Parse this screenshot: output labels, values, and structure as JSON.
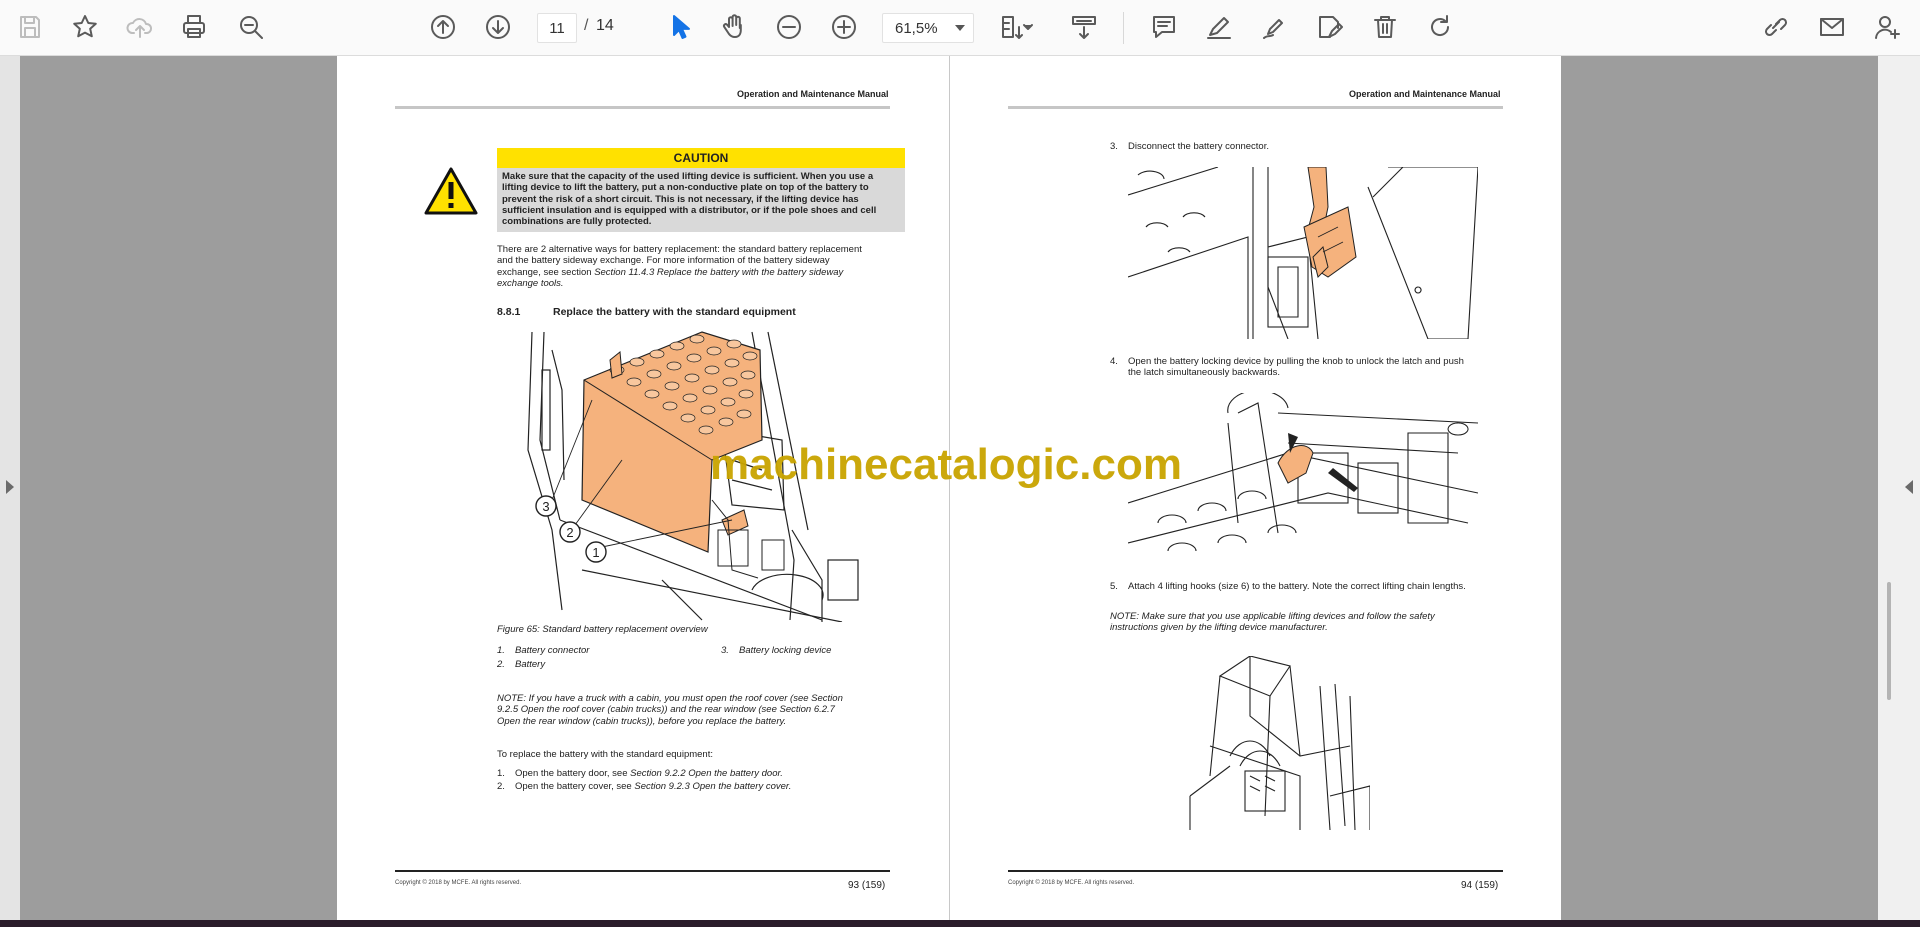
{
  "toolbar": {
    "page_current": "11",
    "page_separator": "/",
    "page_total": "14",
    "zoom_value": "61,5%"
  },
  "left_page": {
    "header": "Operation and Maintenance Manual",
    "caution_title": "CAUTION",
    "caution_text": "Make sure that the capacity of the used lifting device is sufficient. When you use a lifting device to lift the battery, put a non-conductive plate on top of the battery to prevent the risk of a short circuit. This is not necessary, if the lifting device has sufficient insulation and is equipped with a distributor, or if the pole shoes and cell combinations are fully protected.",
    "intro_text": "There are 2 alternative ways for battery replacement: the standard battery replacement and the battery sideway exchange. For more information of the battery sideway exchange, see section",
    "intro_ref": "Section 11.4.3 Replace the battery with the battery sideway exchange tools.",
    "section_number": "8.8.1",
    "section_title": "Replace the battery with the standard equipment",
    "figure_caption": "Figure 65: Standard battery replacement overview",
    "legend": [
      {
        "num": "1.",
        "label": "Battery connector"
      },
      {
        "num": "2.",
        "label": "Battery"
      },
      {
        "num": "3.",
        "label": "Battery locking device"
      }
    ],
    "callouts": [
      "1",
      "2",
      "3"
    ],
    "note_text": "NOTE: If you have a truck with a cabin, you must open the roof cover (see Section 9.2.5 Open the roof cover (cabin trucks)) and the rear window (see Section 6.2.7 Open the rear window (cabin trucks)), before you replace the battery.",
    "procedure_intro": "To replace the battery with the standard equipment:",
    "steps": [
      {
        "num": "1.",
        "text": "Open the battery door, see",
        "ref": "Section 9.2.2 Open the battery door."
      },
      {
        "num": "2.",
        "text": "Open the battery cover, see",
        "ref": "Section 9.2.3 Open the battery cover."
      }
    ],
    "footer_copy": "Copyright © 2018 by MCFE. All rights reserved.",
    "footer_page": "93 (159)"
  },
  "right_page": {
    "header": "Operation and Maintenance Manual",
    "steps": [
      {
        "num": "3.",
        "text": "Disconnect the battery connector."
      },
      {
        "num": "4.",
        "text": "Open the battery locking device by pulling the knob to unlock the latch and push the latch simultaneously backwards."
      },
      {
        "num": "5.",
        "text": "Attach 4 lifting hooks (size 6) to the battery. Note the correct lifting chain lengths."
      }
    ],
    "note_text": "NOTE: Make sure that you use applicable lifting devices and follow the safety instructions given by the lifting device manufacturer.",
    "footer_copy": "Copyright © 2018 by MCFE. All rights reserved.",
    "footer_page": "94 (159)"
  },
  "watermark": "machinecatalogic.com",
  "colors": {
    "caution_yellow": "#ffe100",
    "battery_orange": "#f5b27d",
    "watermark_gold": "#c9a400",
    "selected_tool_blue": "#1473e6"
  }
}
